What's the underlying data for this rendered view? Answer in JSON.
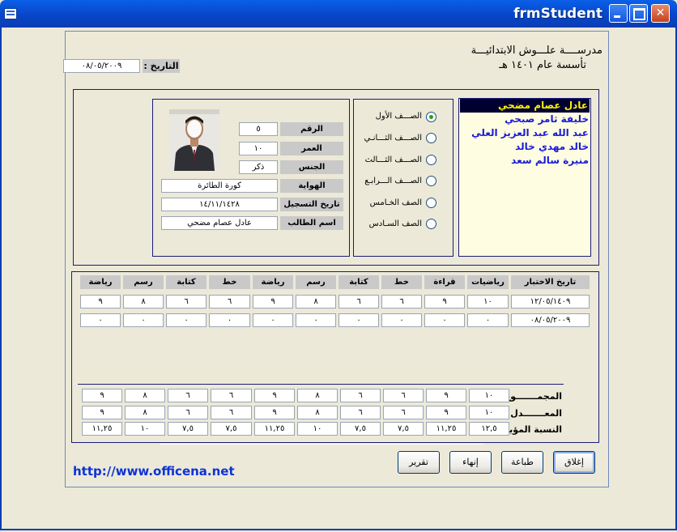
{
  "window": {
    "title": "frmStudent"
  },
  "header": {
    "school_line1": "مدرســــة علـــوش الابتدائيـــة",
    "school_line2": "تأسسة عام ١٤٠١ هـ",
    "date_label": "التاريخ :",
    "date_value": "٠٨/٠٥/٢٠٠٩"
  },
  "students": [
    "عادل عصام مضحي",
    "خليفة ثامر صبحي",
    "عبد الله عبد العزيز  العلي",
    "خالد مهدي خالد",
    "منيرة سالم سعد"
  ],
  "classes": {
    "options": [
      "الصـــف الأول",
      "الصـــف الثـــانـي",
      "الصـــف الثـــالث",
      "الصـــف الـــرابـع",
      "الصف الخـامس",
      "الصف السـادس"
    ],
    "selected": "الصـــف الأول"
  },
  "student_info": {
    "number_label": "الرقم",
    "number_value": "٥",
    "age_label": "العمر",
    "age_value": "١٠",
    "gender_label": "الجنس",
    "gender_value": "ذكر",
    "hobby_label": "الهواية",
    "hobby_value": "كورة الطائرة",
    "regdate_label": "تاريخ التسجيل",
    "regdate_value": "١٤/١١/١٤٢٨",
    "name_label": "اسم الطالب",
    "name_value": "عادل عصام مضحي"
  },
  "grades": {
    "headers": [
      "تاريخ الاختبار",
      "رياضيات",
      "قراءة",
      "خط",
      "كتابة",
      "رسم",
      "رياضة",
      "خط",
      "كتابة",
      "رسم",
      "رياضة"
    ],
    "rows": [
      [
        "١٢/٠٥/١٤٠٩",
        "١٠",
        "٩",
        "٦",
        "٦",
        "٨",
        "٩",
        "٦",
        "٦",
        "٨",
        "٩"
      ],
      [
        "٠٨/٠٥/٢٠٠٩",
        "٠",
        "٠",
        "٠",
        "٠",
        "٠",
        "٠",
        "٠",
        "٠",
        "٠",
        "٠"
      ]
    ],
    "summary": [
      {
        "label": "المجمـــــــوع",
        "values": [
          "١٠",
          "٩",
          "٦",
          "٦",
          "٨",
          "٩",
          "٦",
          "٦",
          "٨",
          "٩"
        ]
      },
      {
        "label": "المعـــــــدل",
        "values": [
          "١٠",
          "٩",
          "٦",
          "٦",
          "٨",
          "٩",
          "٦",
          "٦",
          "٨",
          "٩"
        ]
      },
      {
        "label": "النسبة المؤية",
        "values": [
          "١٢,٥",
          "١١,٢٥",
          "٧,٥",
          "٧,٥",
          "١٠",
          "١١,٢٥",
          "٧,٥",
          "٧,٥",
          "١٠",
          "١١,٢٥"
        ]
      }
    ]
  },
  "buttons": {
    "close": "إغلاق",
    "print": "طباعة",
    "end": "إنهاء",
    "report": "تقرير"
  },
  "footer": {
    "url": "http://www.officena.net"
  },
  "colors": {
    "titlebar": "#0A4FD8",
    "selection_bg": "#000030",
    "selection_fg": "#FFF200",
    "list_bg": "#FFFDE1",
    "student_text": "#1A1AD8",
    "url": "#0B33D6"
  }
}
